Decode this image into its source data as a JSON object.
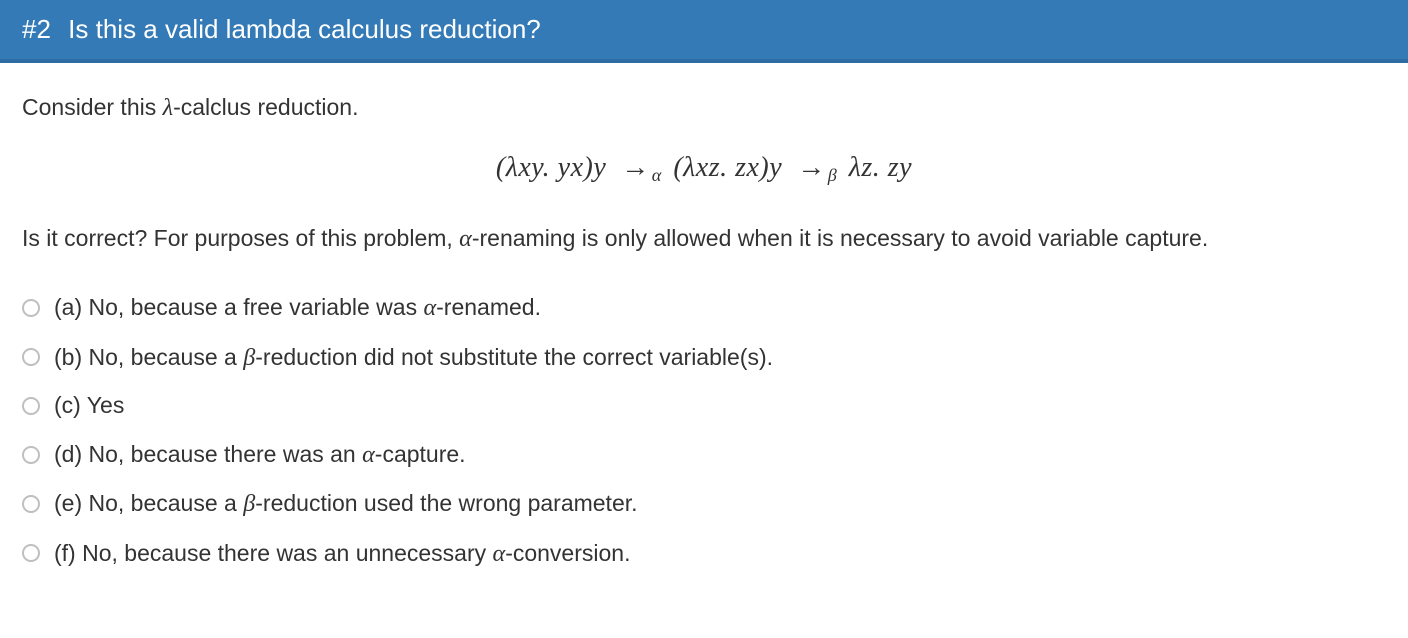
{
  "header": {
    "number": "#2",
    "title": "Is this a valid lambda calculus reduction?"
  },
  "question": {
    "intro_before": "Consider this ",
    "intro_lambda": "λ",
    "intro_after": "-calclus reduction.",
    "equation_html": "(<span>λxy</span>.&nbsp;<span>yx</span>)<span>y</span> &nbsp;→<span class='sub'>α</span> (<span>λxz</span>.&nbsp;<span>zx</span>)<span>y</span> &nbsp;→<span class='sub'>β</span> <span>λz</span>.&nbsp;<span>zy</span>",
    "followup_before": "Is it correct? For purposes of this problem, ",
    "followup_alpha": "α",
    "followup_after": "-renaming is only allowed when it is necessary to avoid variable capture."
  },
  "options": [
    {
      "key": "a",
      "pre": "(a) No, because a free variable was ",
      "mi": "α",
      "post": "-renamed."
    },
    {
      "key": "b",
      "pre": "(b) No, because a ",
      "mi": "β",
      "post": "-reduction did not substitute the correct variable(s)."
    },
    {
      "key": "c",
      "pre": "(c) Yes",
      "mi": "",
      "post": ""
    },
    {
      "key": "d",
      "pre": "(d) No, because there was an ",
      "mi": "α",
      "post": "-capture."
    },
    {
      "key": "e",
      "pre": "(e) No, because a ",
      "mi": "β",
      "post": "-reduction used the wrong parameter."
    },
    {
      "key": "f",
      "pre": "(f) No, because there was an unnecessary ",
      "mi": "α",
      "post": "-conversion."
    }
  ]
}
